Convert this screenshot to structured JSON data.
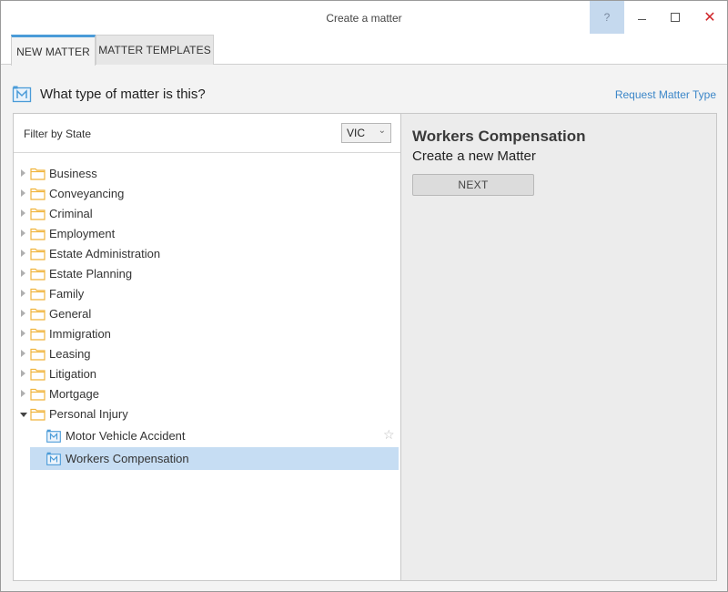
{
  "window": {
    "title": "Create a matter",
    "help_label": "?",
    "close_label": "✕"
  },
  "tabs": [
    {
      "label": "NEW MATTER",
      "active": true
    },
    {
      "label": "MATTER TEMPLATES",
      "active": false
    }
  ],
  "header": {
    "question": "What type of matter is this?",
    "request_link": "Request Matter Type"
  },
  "filter": {
    "label": "Filter by State",
    "selected_state": "VIC"
  },
  "tree": {
    "categories": [
      {
        "label": "Business",
        "expanded": false
      },
      {
        "label": "Conveyancing",
        "expanded": false
      },
      {
        "label": "Criminal",
        "expanded": false
      },
      {
        "label": "Employment",
        "expanded": false
      },
      {
        "label": "Estate Administration",
        "expanded": false
      },
      {
        "label": "Estate Planning",
        "expanded": false
      },
      {
        "label": "Family",
        "expanded": false
      },
      {
        "label": "General",
        "expanded": false
      },
      {
        "label": "Immigration",
        "expanded": false
      },
      {
        "label": "Leasing",
        "expanded": false
      },
      {
        "label": "Litigation",
        "expanded": false
      },
      {
        "label": "Mortgage",
        "expanded": false
      },
      {
        "label": "Personal Injury",
        "expanded": true
      }
    ],
    "children": [
      {
        "label": "Motor Vehicle Accident",
        "selected": false
      },
      {
        "label": "Workers Compensation",
        "selected": true
      }
    ]
  },
  "detail": {
    "title": "Workers Compensation",
    "subtitle": "Create a new Matter",
    "next_label": "NEXT"
  },
  "colors": {
    "accent": "#4a9bd8",
    "link": "#3b86c8",
    "folder": "#f0b43c",
    "selected_row": "#c6ddf3",
    "close": "#d0262b"
  }
}
